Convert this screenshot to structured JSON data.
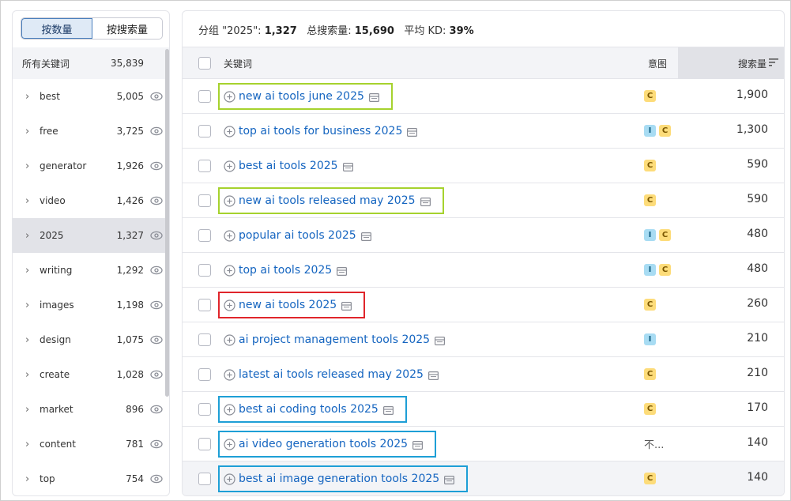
{
  "toggle": {
    "by_count": "按数量",
    "by_volume": "按搜索量"
  },
  "sidebar": {
    "all": {
      "label": "所有关键词",
      "count": "35,839"
    },
    "items": [
      {
        "label": "best",
        "count": "5,005"
      },
      {
        "label": "free",
        "count": "3,725"
      },
      {
        "label": "generator",
        "count": "1,926"
      },
      {
        "label": "video",
        "count": "1,426"
      },
      {
        "label": "2025",
        "count": "1,327"
      },
      {
        "label": "writing",
        "count": "1,292"
      },
      {
        "label": "images",
        "count": "1,198"
      },
      {
        "label": "design",
        "count": "1,075"
      },
      {
        "label": "create",
        "count": "1,028"
      },
      {
        "label": "market",
        "count": "896"
      },
      {
        "label": "content",
        "count": "781"
      },
      {
        "label": "top",
        "count": "754"
      }
    ],
    "selected_index": 4
  },
  "summary": {
    "group_label": "分组 \"2025\":",
    "group_value": "1,327",
    "total_label": "总搜索量:",
    "total_value": "15,690",
    "kd_label": "平均 KD:",
    "kd_value": "39%"
  },
  "table": {
    "headers": {
      "keyword": "关键词",
      "intent": "意图",
      "volume": "搜索量"
    },
    "rows": [
      {
        "keyword": "new ai tools june 2025",
        "intents": [
          "C"
        ],
        "volume": "1,900",
        "highlight": "green"
      },
      {
        "keyword": "top ai tools for business 2025",
        "intents": [
          "I",
          "C"
        ],
        "volume": "1,300"
      },
      {
        "keyword": "best ai tools 2025",
        "intents": [
          "C"
        ],
        "volume": "590"
      },
      {
        "keyword": "new ai tools released may 2025",
        "intents": [
          "C"
        ],
        "volume": "590",
        "highlight": "green"
      },
      {
        "keyword": "popular ai tools 2025",
        "intents": [
          "I",
          "C"
        ],
        "volume": "480"
      },
      {
        "keyword": "top ai tools 2025",
        "intents": [
          "I",
          "C"
        ],
        "volume": "480"
      },
      {
        "keyword": "new ai tools 2025",
        "intents": [
          "C"
        ],
        "volume": "260",
        "highlight": "red"
      },
      {
        "keyword": "ai project management tools 2025",
        "intents": [
          "I"
        ],
        "volume": "210"
      },
      {
        "keyword": "latest ai tools released may 2025",
        "intents": [
          "C"
        ],
        "volume": "210"
      },
      {
        "keyword": "best ai coding tools 2025",
        "intents": [
          "C"
        ],
        "volume": "170",
        "highlight": "blue"
      },
      {
        "keyword": "ai video generation tools 2025",
        "intents": [],
        "intent_text": "不...",
        "volume": "140",
        "highlight": "blue"
      },
      {
        "keyword": "best ai image generation tools 2025",
        "intents": [
          "C"
        ],
        "volume": "140",
        "highlight": "blue"
      }
    ]
  },
  "colors": {
    "link": "#1565c0",
    "intent_commercial": "#fddc7a",
    "intent_informational": "#a8dcf3",
    "highlight_green": "#a6d22e",
    "highlight_red": "#e0252b",
    "highlight_blue": "#1e9fd6"
  },
  "icons": [
    "chevron-right-icon",
    "eye-icon",
    "plus-circle-icon",
    "serp-features-icon",
    "sort-icon"
  ]
}
